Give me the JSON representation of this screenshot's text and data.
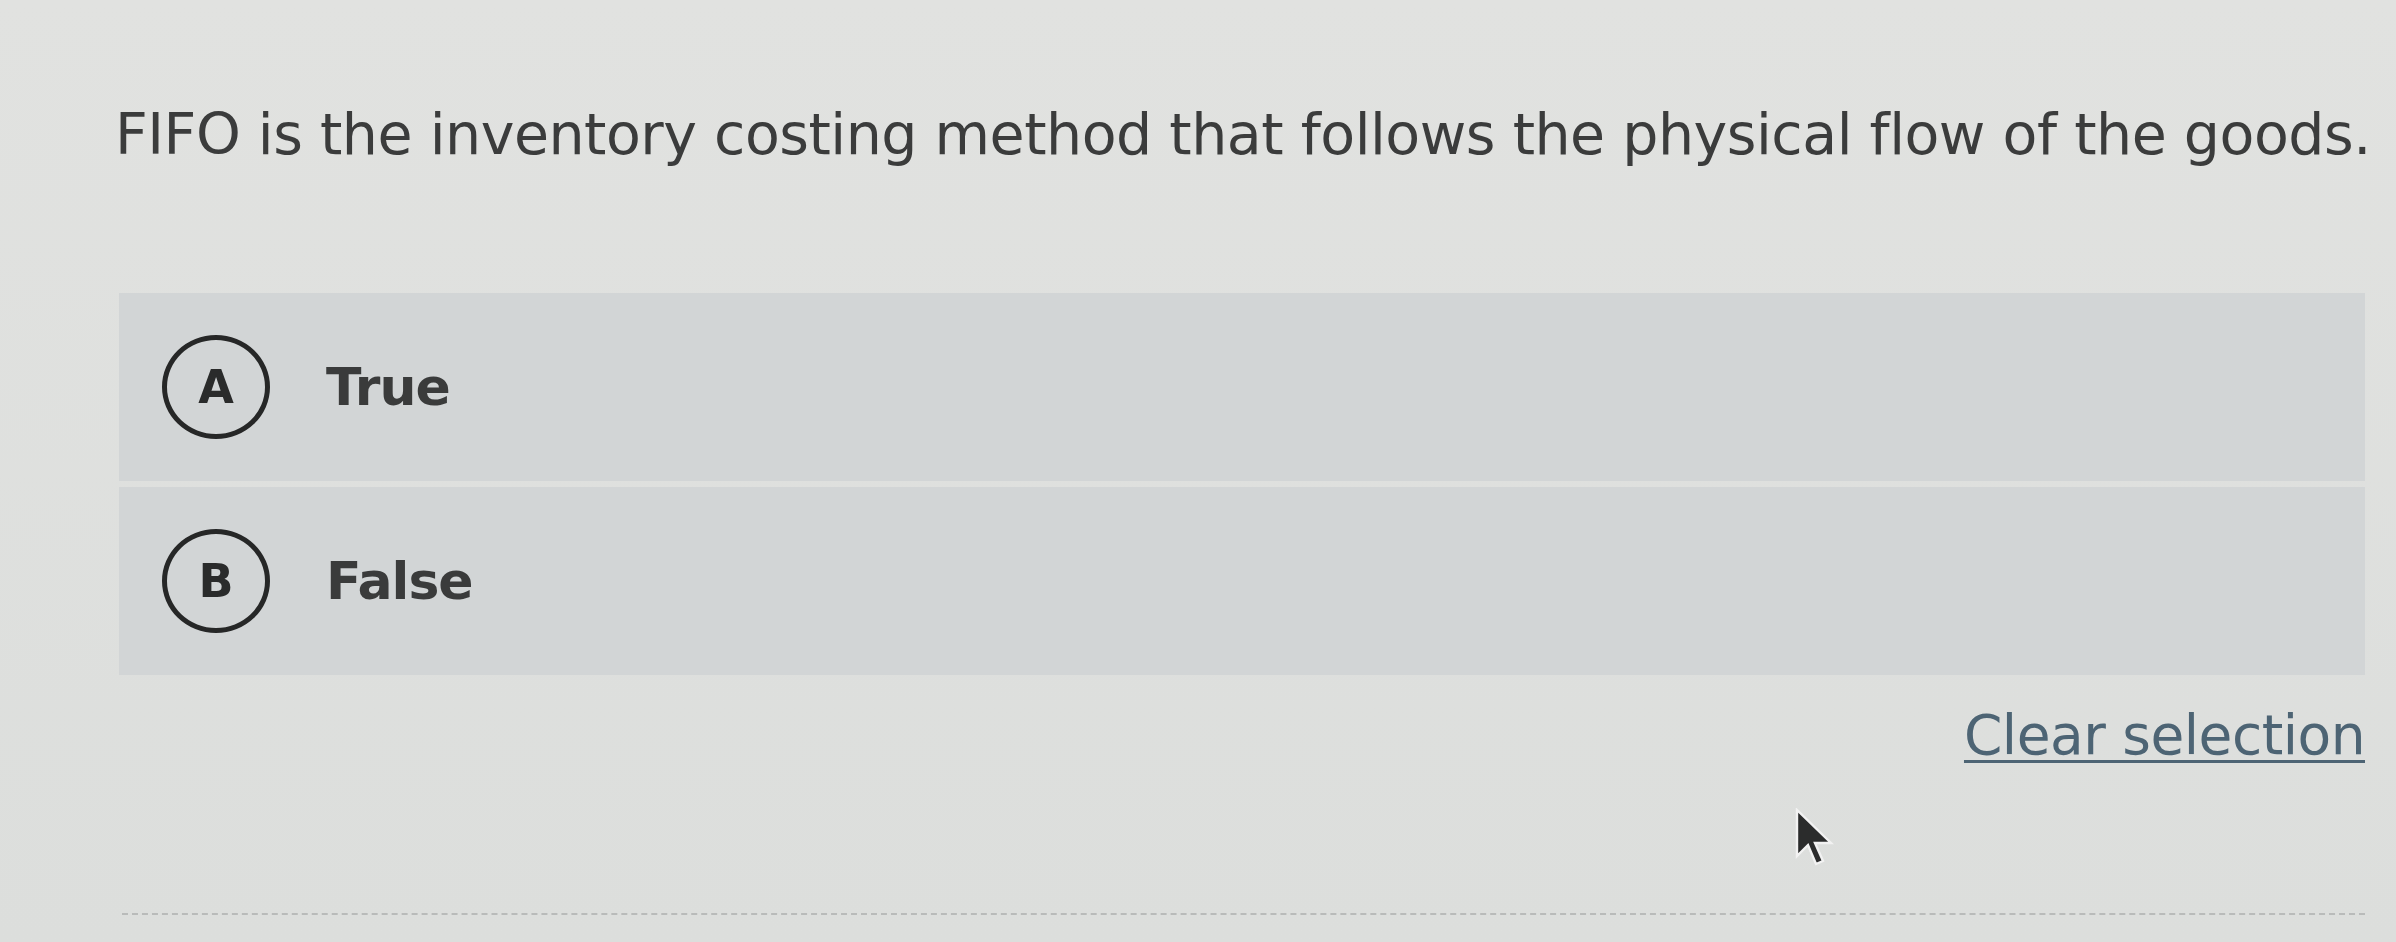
{
  "question": {
    "text": "FIFO is the inventory costing method that follows the physical flow of the goods."
  },
  "options": [
    {
      "letter": "A",
      "label": "True",
      "selected": false
    },
    {
      "letter": "B",
      "label": "False",
      "selected": false
    }
  ],
  "clear_selection": {
    "label": "Clear selection"
  }
}
